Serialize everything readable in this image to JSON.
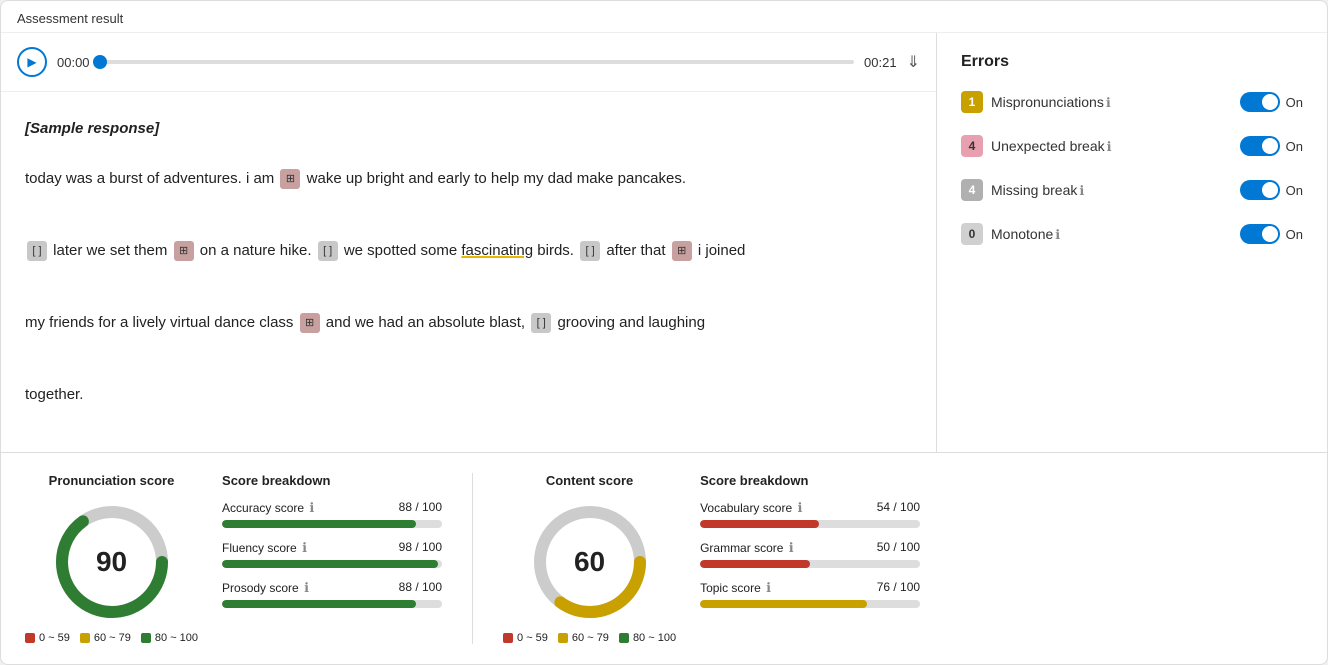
{
  "page": {
    "title": "Assessment result"
  },
  "audio": {
    "time_start": "00:00",
    "time_end": "00:21",
    "progress_percent": 0
  },
  "transcript": {
    "sample_label": "[Sample response]",
    "text_segments": [
      {
        "type": "text",
        "value": "today was a burst of adventures. i am "
      },
      {
        "type": "error_red",
        "value": "⊞"
      },
      {
        "type": "text",
        "value": " wake up bright and early to help my dad make pancakes."
      },
      {
        "type": "newline"
      },
      {
        "type": "error_gray",
        "value": "[ ]"
      },
      {
        "type": "text",
        "value": " later we set them "
      },
      {
        "type": "error_red",
        "value": "⊞"
      },
      {
        "type": "text",
        "value": " on a nature hike. "
      },
      {
        "type": "error_gray",
        "value": "[ ]"
      },
      {
        "type": "text",
        "value": " we spotted some "
      },
      {
        "type": "highlight",
        "value": "fascinating"
      },
      {
        "type": "text",
        "value": " birds. "
      },
      {
        "type": "error_gray",
        "value": "[ ]"
      },
      {
        "type": "text",
        "value": " after that "
      },
      {
        "type": "error_red",
        "value": "⊞"
      },
      {
        "type": "text",
        "value": " i joined"
      },
      {
        "type": "newline"
      },
      {
        "type": "text",
        "value": "my friends for a lively virtual dance class "
      },
      {
        "type": "error_red",
        "value": "⊞"
      },
      {
        "type": "text",
        "value": " and we had an absolute blast, "
      },
      {
        "type": "error_gray",
        "value": "[ ]"
      },
      {
        "type": "text",
        "value": " grooving and laughing"
      },
      {
        "type": "newline"
      },
      {
        "type": "text",
        "value": "together."
      }
    ]
  },
  "errors": {
    "title": "Errors",
    "items": [
      {
        "badge": "1",
        "badge_class": "badge-yellow",
        "label": "Mispronunciations",
        "toggle_label": "On"
      },
      {
        "badge": "4",
        "badge_class": "badge-pink",
        "label": "Unexpected break",
        "toggle_label": "On"
      },
      {
        "badge": "4",
        "badge_class": "badge-gray",
        "label": "Missing break",
        "toggle_label": "On"
      },
      {
        "badge": "0",
        "badge_class": "badge-gray0",
        "label": "Monotone",
        "toggle_label": "On"
      }
    ]
  },
  "pronunciation_score": {
    "title": "Pronunciation score",
    "value": 90,
    "donut": {
      "green_percent": 90,
      "gray_percent": 10
    },
    "breakdown_title": "Score breakdown",
    "breakdown": [
      {
        "label": "Accuracy score",
        "info": true,
        "value": "88 / 100",
        "percent": 88,
        "bar_class": "bar-green"
      },
      {
        "label": "Fluency score",
        "info": true,
        "value": "98 / 100",
        "percent": 98,
        "bar_class": "bar-green"
      },
      {
        "label": "Prosody score",
        "info": true,
        "value": "88 / 100",
        "percent": 88,
        "bar_class": "bar-green"
      }
    ],
    "legend": [
      {
        "color": "dot-red",
        "label": "0 ~ 59"
      },
      {
        "color": "dot-yellow",
        "label": "60 ~ 79"
      },
      {
        "color": "dot-green",
        "label": "80 ~ 100"
      }
    ]
  },
  "content_score": {
    "title": "Content score",
    "value": 60,
    "donut": {
      "yellow_percent": 60,
      "gray_percent": 40
    },
    "breakdown_title": "Score breakdown",
    "breakdown": [
      {
        "label": "Vocabulary score",
        "info": true,
        "value": "54 / 100",
        "percent": 54,
        "bar_class": "bar-red"
      },
      {
        "label": "Grammar score",
        "info": true,
        "value": "50 / 100",
        "percent": 50,
        "bar_class": "bar-red"
      },
      {
        "label": "Topic score",
        "info": true,
        "value": "76 / 100",
        "percent": 76,
        "bar_class": "bar-yellow"
      }
    ],
    "legend": [
      {
        "color": "dot-red",
        "label": "0 ~ 59"
      },
      {
        "color": "dot-yellow",
        "label": "60 ~ 79"
      },
      {
        "color": "dot-green",
        "label": "80 ~ 100"
      }
    ]
  }
}
